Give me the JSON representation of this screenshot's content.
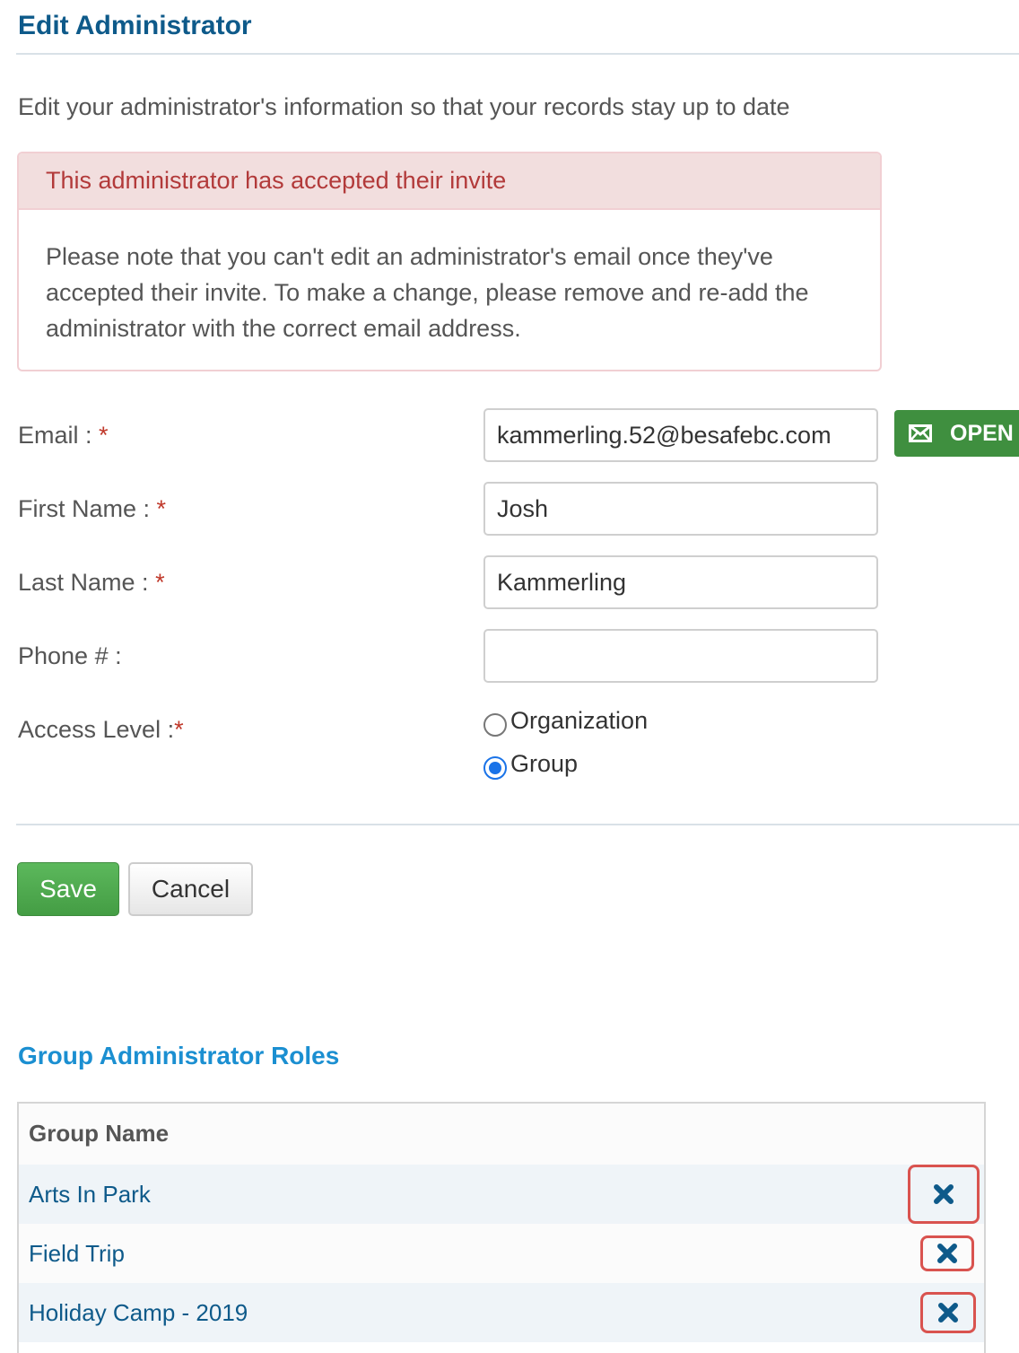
{
  "page": {
    "title": "Edit Administrator",
    "intro": "Edit your administrator's information so that your records stay up to date"
  },
  "alert": {
    "heading": "This administrator has accepted their invite",
    "body": "Please note that you can't edit an administrator's email once they've accepted their invite. To make a change, please remove and re-add the administrator with the correct email address."
  },
  "form": {
    "email_label": "Email : ",
    "email_value": "kammerling.52@besafebc.com",
    "first_name_label": "First Name : ",
    "first_name_value": "Josh",
    "last_name_label": "Last Name : ",
    "last_name_value": "Kammerling",
    "phone_label": "Phone # : ",
    "phone_value": "",
    "access_label": "Access Level :",
    "required_mark": "*",
    "access_options": [
      "Organization",
      "Group"
    ],
    "access_selected": "Group",
    "open_label": "OPEN"
  },
  "actions": {
    "save_label": "Save",
    "cancel_label": "Cancel"
  },
  "roles": {
    "title": "Group Administrator Roles",
    "column_header": "Group Name",
    "rows": [
      "Arts In Park",
      "Field Trip",
      "Holiday Camp - 2019"
    ]
  },
  "colors": {
    "title": "#0e5a8a",
    "section_title": "#1b8fd1",
    "alert_bg": "#f2dede",
    "alert_text": "#b23a3a",
    "save": "#5cb85c",
    "open_button": "#3f8f3f",
    "remove_highlight": "#d9534f"
  },
  "icons": {
    "open_button": "envelope-icon",
    "remove": "close-x-icon"
  }
}
